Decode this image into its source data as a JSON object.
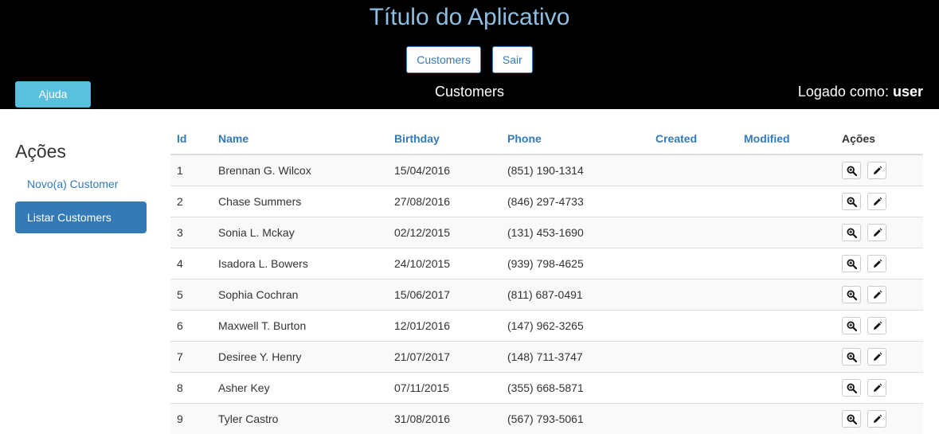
{
  "header": {
    "app_title": "Título do Aplicativo",
    "nav": [
      "Customers",
      "Sair"
    ],
    "help_label": "Ajuda",
    "page_heading": "Customers",
    "logged_prefix": "Logado como:",
    "logged_user": "user"
  },
  "sidebar": {
    "title": "Ações",
    "new_label": "Novo(a) Customer",
    "list_label": "Listar Customers"
  },
  "table": {
    "columns": [
      "Id",
      "Name",
      "Birthday",
      "Phone",
      "Created",
      "Modified",
      "Ações"
    ],
    "rows": [
      {
        "id": "1",
        "name": "Brennan G. Wilcox",
        "birthday": "15/04/2016",
        "phone": "(851) 190-1314",
        "created": "",
        "modified": ""
      },
      {
        "id": "2",
        "name": "Chase Summers",
        "birthday": "27/08/2016",
        "phone": "(846) 297-4733",
        "created": "",
        "modified": ""
      },
      {
        "id": "3",
        "name": "Sonia L. Mckay",
        "birthday": "02/12/2015",
        "phone": "(131) 453-1690",
        "created": "",
        "modified": ""
      },
      {
        "id": "4",
        "name": "Isadora L. Bowers",
        "birthday": "24/10/2015",
        "phone": "(939) 798-4625",
        "created": "",
        "modified": ""
      },
      {
        "id": "5",
        "name": "Sophia Cochran",
        "birthday": "15/06/2017",
        "phone": "(811) 687-0491",
        "created": "",
        "modified": ""
      },
      {
        "id": "6",
        "name": "Maxwell T. Burton",
        "birthday": "12/01/2016",
        "phone": "(147) 962-3265",
        "created": "",
        "modified": ""
      },
      {
        "id": "7",
        "name": "Desiree Y. Henry",
        "birthday": "21/07/2017",
        "phone": "(148) 711-3747",
        "created": "",
        "modified": ""
      },
      {
        "id": "8",
        "name": "Asher Key",
        "birthday": "07/11/2015",
        "phone": "(355) 668-5871",
        "created": "",
        "modified": ""
      },
      {
        "id": "9",
        "name": "Tyler Castro",
        "birthday": "31/08/2016",
        "phone": "(567) 793-5061",
        "created": "",
        "modified": ""
      }
    ],
    "row_actions": [
      "zoom-in-icon",
      "pencil-icon"
    ]
  },
  "colors": {
    "header_bg": "#000000",
    "title_color": "#8fbfe0",
    "primary": "#337ab7",
    "info": "#5bc0de"
  }
}
